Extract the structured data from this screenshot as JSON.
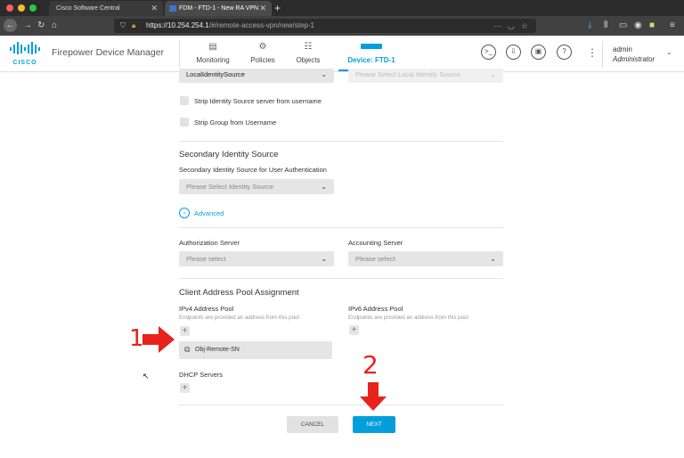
{
  "browser": {
    "tabs": [
      {
        "label": "Cisco Software Central",
        "active": false
      },
      {
        "label": "FDM - FTD-1 - New RA VPN",
        "active": true
      }
    ],
    "url_host": "https://10.254.254.1",
    "url_path": "/#/remote-access-vpn/new/step-1"
  },
  "header": {
    "logo_text": "CISCO",
    "app_title": "Firepower Device Manager",
    "nav": [
      {
        "label": "Monitoring"
      },
      {
        "label": "Policies"
      },
      {
        "label": "Objects"
      },
      {
        "label": "Device: FTD-1",
        "active": true
      }
    ],
    "user_name": "admin",
    "user_role": "Administrator"
  },
  "form": {
    "primary_source_value": "LocalIdentitySource",
    "local_source_placeholder": "Please Select Local Identity Source",
    "strip_source_label": "Strip Identity Source server from username",
    "strip_group_label": "Strip Group from Username",
    "secondary_heading": "Secondary Identity Source",
    "secondary_label": "Secondary Identity Source for User Authentication",
    "secondary_placeholder": "Please Select Identity Source",
    "advanced_label": "Advanced",
    "authorization_label": "Authorization Server",
    "authorization_placeholder": "Please select",
    "accounting_label": "Accounting Server",
    "accounting_placeholder": "Please select",
    "pool_heading": "Client Address Pool Assignment",
    "ipv4_label": "IPv4 Address Pool",
    "ipv4_hint": "Endpoints are provided an address from this pool",
    "ipv6_label": "IPv6 Address Pool",
    "ipv6_hint": "Endpoints are provided an address from this pool",
    "ipv4_object": "Obj-Remote-SN",
    "dhcp_label": "DHCP Servers",
    "cancel_label": "CANCEL",
    "next_label": "NEXT"
  },
  "annotations": {
    "step1": "1",
    "step2": "2"
  },
  "colors": {
    "accent": "#049fd9",
    "annotation": "#e8221c"
  }
}
